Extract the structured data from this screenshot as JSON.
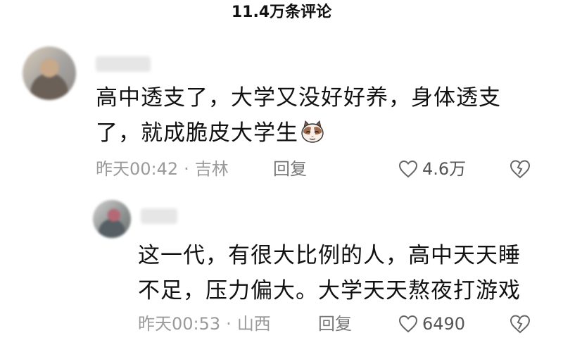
{
  "header": {
    "title": "11.4万条评论"
  },
  "comments": [
    {
      "text_line1": "高中透支了，大学又没好好养，身体透支",
      "text_line2": "了，就成脆皮大学生",
      "emoji_icon": "cat-face-icon",
      "time": "昨天00:42",
      "dot": "·",
      "location": "吉林",
      "reply_label": "回复",
      "likes": "4.6万",
      "icons": {
        "like": "heart-outline-icon",
        "dislike": "broken-heart-icon"
      },
      "reply": {
        "text_line1": "这一代，有很大比例的人，高中天天睡",
        "text_line2": "不足，压力偏大。大学天天熬夜打游戏",
        "time": "昨天00:53",
        "dot": "·",
        "location": "山西",
        "reply_label": "回复",
        "likes": "6490"
      }
    }
  ]
}
